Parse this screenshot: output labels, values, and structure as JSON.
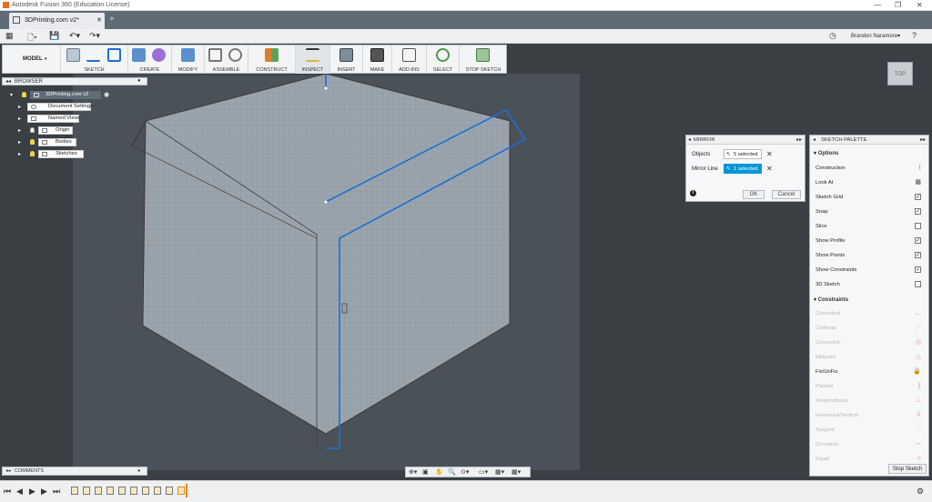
{
  "app": {
    "title": "Autodesk Fusion 360 (Education License)"
  },
  "tab": {
    "name": "3DPrinting.com v2*"
  },
  "quick_access": {
    "user": "Brandon Naramore"
  },
  "ribbon": {
    "workspace": "MODEL",
    "groups": [
      "SKETCH",
      "CREATE",
      "MODIFY",
      "ASSEMBLE",
      "CONSTRUCT",
      "INSPECT",
      "INSERT",
      "MAKE",
      "ADD-INS",
      "SELECT",
      "STOP SKETCH"
    ]
  },
  "browser": {
    "title": "BROWSER",
    "root": "3DPrinting.com v2",
    "items": [
      "Document Settings",
      "Named Views",
      "Origin",
      "Bodies",
      "Sketches"
    ]
  },
  "mirror": {
    "title": "MIRROR",
    "objects_label": "Objects",
    "objects_value": "5 selected",
    "mirror_line_label": "Mirror Line",
    "mirror_line_value": "1 selected",
    "ok": "OK",
    "cancel": "Cancel"
  },
  "palette": {
    "title": "SKETCH PALETTE",
    "options_header": "Options",
    "options": [
      {
        "label": "Construction",
        "state": "icon"
      },
      {
        "label": "Look At",
        "state": "icon"
      },
      {
        "label": "Sketch Grid",
        "state": "checked"
      },
      {
        "label": "Snap",
        "state": "checked"
      },
      {
        "label": "Slice",
        "state": "unchecked"
      },
      {
        "label": "Show Profile",
        "state": "checked"
      },
      {
        "label": "Show Points",
        "state": "checked"
      },
      {
        "label": "Show Constraints",
        "state": "checked"
      },
      {
        "label": "3D Sketch",
        "state": "unchecked"
      }
    ],
    "constraints_header": "Constraints",
    "constraints": [
      "Coincident",
      "Collinear",
      "Concentric",
      "Midpoint",
      "Fix/UnFix",
      "Parallel",
      "Perpendicular",
      "Horizontal/Vertical",
      "Tangent",
      "Curvature",
      "Equal"
    ],
    "stop_sketch": "Stop Sketch"
  },
  "viewcube": {
    "face": "TOP"
  },
  "comments": {
    "title": "COMMENTS"
  },
  "colors": {
    "accent": "#1d6fd6",
    "selected_field": "#0696d7",
    "bulb": "#f2d34a"
  }
}
